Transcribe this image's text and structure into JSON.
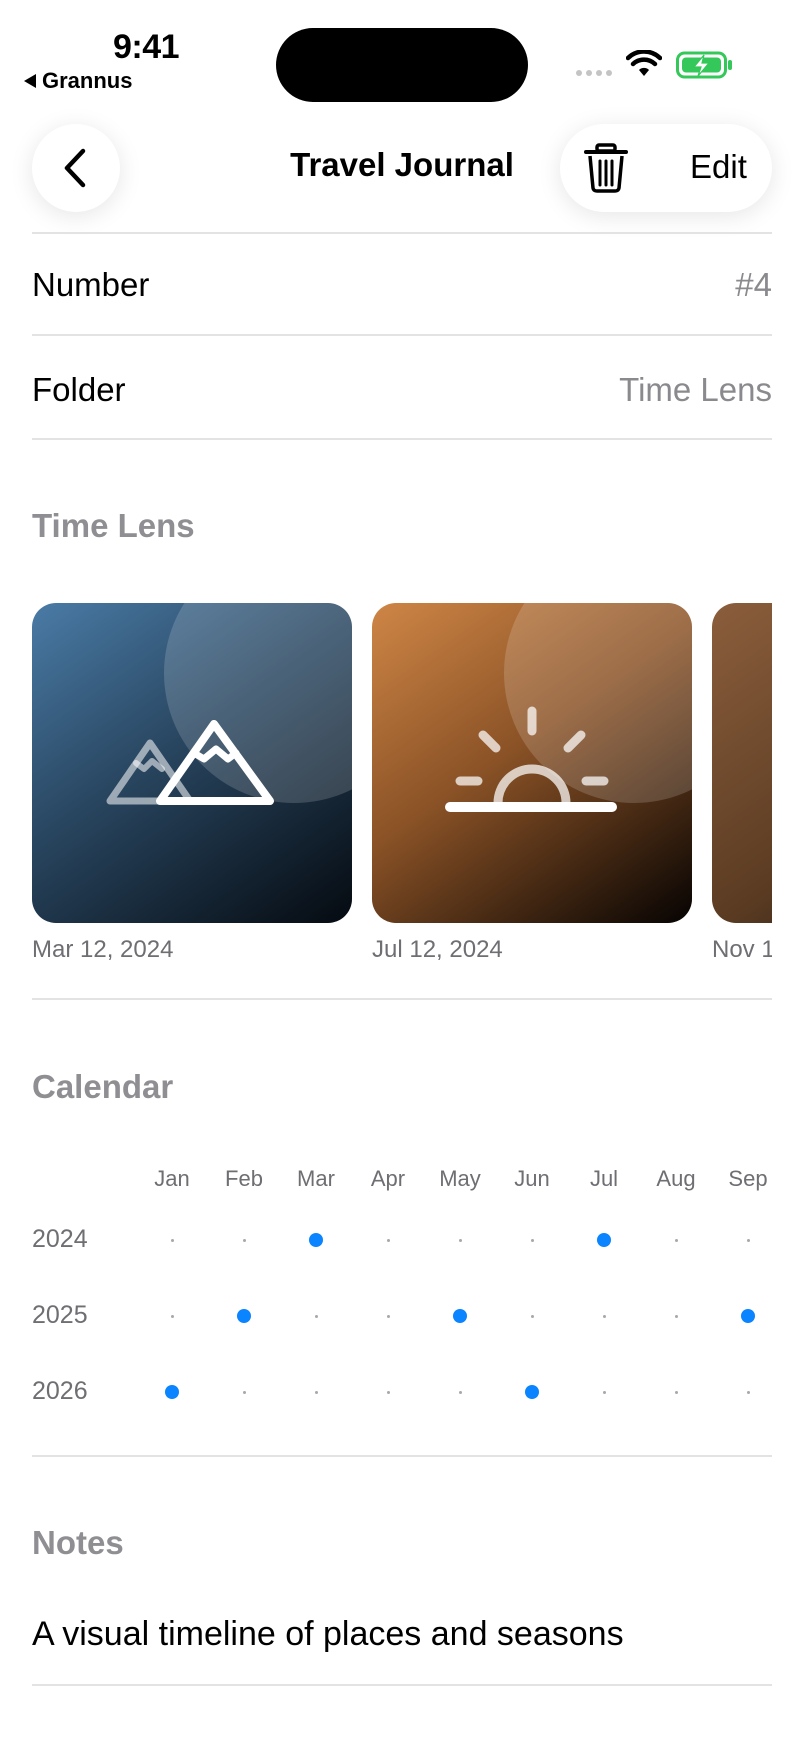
{
  "status_bar": {
    "time": "9:41",
    "back_app": "Grannus",
    "battery_color": "#34c759",
    "icons": [
      "signal-icon",
      "wifi-icon",
      "battery-charging-icon"
    ]
  },
  "nav": {
    "title": "Travel Journal",
    "edit_label": "Edit",
    "icons": [
      "chevron-left-icon",
      "trash-icon"
    ]
  },
  "details": {
    "number_label": "Number",
    "number_value": "#4",
    "folder_label": "Folder",
    "folder_value": "Time Lens"
  },
  "time_lens": {
    "title": "Time Lens",
    "items": [
      {
        "date": "Mar 12, 2024",
        "icon": "mountains-icon",
        "color": "#4a7ba6"
      },
      {
        "date": "Jul 12, 2024",
        "icon": "sunset-icon",
        "color": "#cf8646"
      },
      {
        "date": "Nov 1",
        "icon": "unknown-icon",
        "color": "#8b5e3c"
      }
    ]
  },
  "calendar": {
    "title": "Calendar",
    "accent": "#0a84ff",
    "months": [
      "Jan",
      "Feb",
      "Mar",
      "Apr",
      "May",
      "Jun",
      "Jul",
      "Aug",
      "Sep"
    ],
    "years": [
      {
        "year": "2024",
        "marked_months": [
          "Mar",
          "Jul"
        ]
      },
      {
        "year": "2025",
        "marked_months": [
          "Feb",
          "May",
          "Sep"
        ]
      },
      {
        "year": "2026",
        "marked_months": [
          "Jan",
          "Jun"
        ]
      }
    ]
  },
  "notes": {
    "title": "Notes",
    "text": "A visual timeline of places and seasons"
  }
}
